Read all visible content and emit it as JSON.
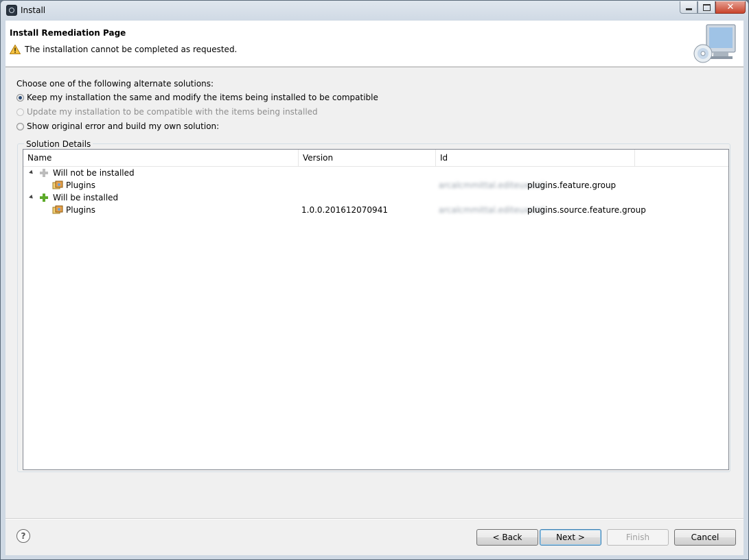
{
  "window": {
    "title": "Install"
  },
  "banner": {
    "title": "Install Remediation Page",
    "message": "The installation cannot be completed as requested."
  },
  "solutions": {
    "prompt": "Choose one of the following alternate solutions:",
    "options": [
      {
        "label": "Keep my installation the same and modify the items being installed to be compatible",
        "selected": true,
        "enabled": true
      },
      {
        "label": "Update my installation to be compatible with the items being installed",
        "selected": false,
        "enabled": false
      },
      {
        "label": "Show original error and build my own solution:",
        "selected": false,
        "enabled": true
      }
    ]
  },
  "details": {
    "group_label": "Solution Details",
    "columns": [
      "Name",
      "Version",
      "Id"
    ],
    "rows": [
      {
        "name": "Will not be installed",
        "version": "",
        "id_prefix": "",
        "id": ""
      },
      {
        "name": "Plugins",
        "version": "",
        "id_prefix": "arcalcmmittal.editeuxxml.",
        "id": "plugins.feature.group"
      },
      {
        "name": "Will be installed",
        "version": "",
        "id_prefix": "",
        "id": ""
      },
      {
        "name": "Plugins",
        "version": "1.0.0.201612070941",
        "id_prefix": "arcalcmmittal.editeuxxml.",
        "id": "plugins.source.feature.group"
      }
    ]
  },
  "buttons": {
    "back": "< Back",
    "next": "Next >",
    "finish": "Finish",
    "cancel": "Cancel"
  },
  "icons": {
    "help": "?",
    "close": "✕"
  }
}
